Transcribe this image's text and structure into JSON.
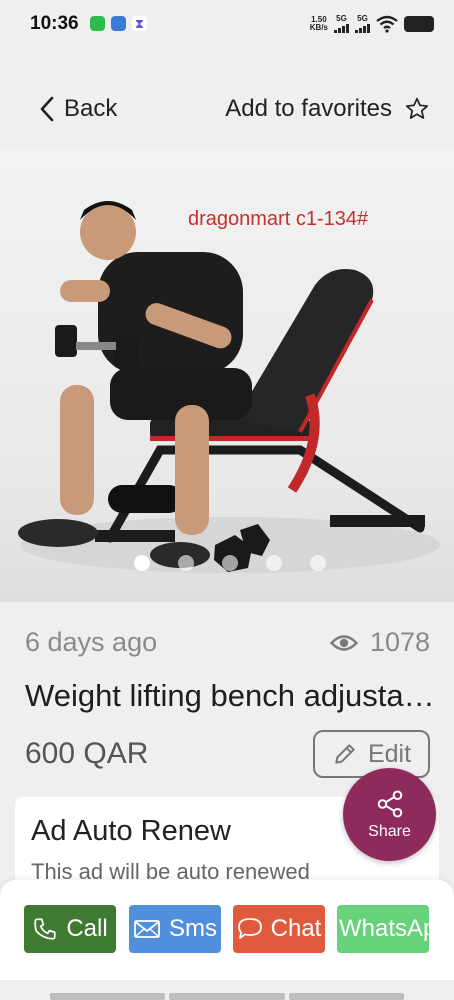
{
  "status_bar": {
    "time": "10:36",
    "net_speed_value": "1.50",
    "net_speed_unit": "KB/s",
    "net_label_1": "5G",
    "net_label_2": "5G"
  },
  "header": {
    "back_label": "Back",
    "favorite_label": "Add to favorites"
  },
  "image": {
    "watermark": "dragonmart c1-134#",
    "slide_count": 5,
    "active_slide": 1
  },
  "listing": {
    "posted": "6 days ago",
    "views": "1078",
    "title": "Weight lifting bench adjustable",
    "price": "600 QAR",
    "edit_label": "Edit"
  },
  "auto_renew": {
    "title": "Ad Auto Renew",
    "description": "This ad will be auto renewed"
  },
  "share": {
    "label": "Share"
  },
  "actions": {
    "call": "Call",
    "sms": "Sms",
    "chat": "Chat",
    "whatsapp": "WhatsApp"
  },
  "colors": {
    "share": "#8e2b5c",
    "call": "#3f7a32",
    "sms": "#4f8fdb",
    "chat": "#e05b3d",
    "whatsapp": "#66d37a"
  },
  "icons": [
    "back-chevron-icon",
    "star-outline-icon",
    "eye-icon",
    "pencil-icon",
    "share-icon",
    "phone-icon",
    "mail-icon",
    "chat-bubble-icon"
  ]
}
